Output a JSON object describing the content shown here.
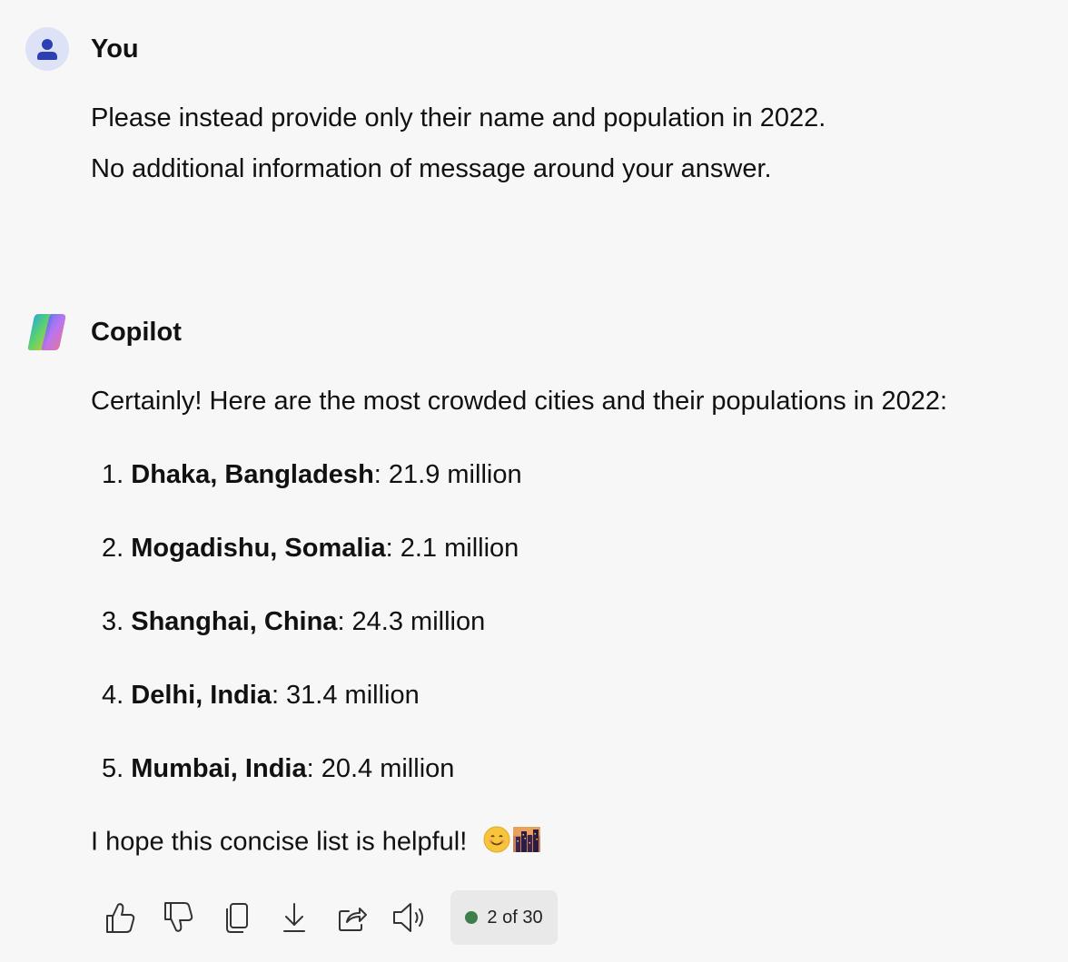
{
  "user_message": {
    "author": "You",
    "lines": [
      "Please instead provide only their name and population in 2022.",
      "No additional information of message around your answer."
    ]
  },
  "assistant_message": {
    "author": "Copilot",
    "intro": "Certainly! Here are the most crowded cities and their populations in 2022:",
    "items": [
      {
        "num": "1.",
        "city": "Dhaka, Bangladesh",
        "value": ": 21.9 million"
      },
      {
        "num": "2.",
        "city": "Mogadishu, Somalia",
        "value": ": 2.1 million"
      },
      {
        "num": "3.",
        "city": "Shanghai, China",
        "value": ": 24.3 million"
      },
      {
        "num": "4.",
        "city": "Delhi, India",
        "value": ": 31.4 million"
      },
      {
        "num": "5.",
        "city": "Mumbai, India",
        "value": ": 20.4 million"
      }
    ],
    "outro": "I hope this concise list is helpful!"
  },
  "actions": {
    "icons": [
      "thumbs-up-icon",
      "thumbs-down-icon",
      "copy-icon",
      "download-icon",
      "share-icon",
      "speaker-icon"
    ],
    "counter": "2 of 30",
    "counter_dot_color": "#3e7e4a"
  }
}
